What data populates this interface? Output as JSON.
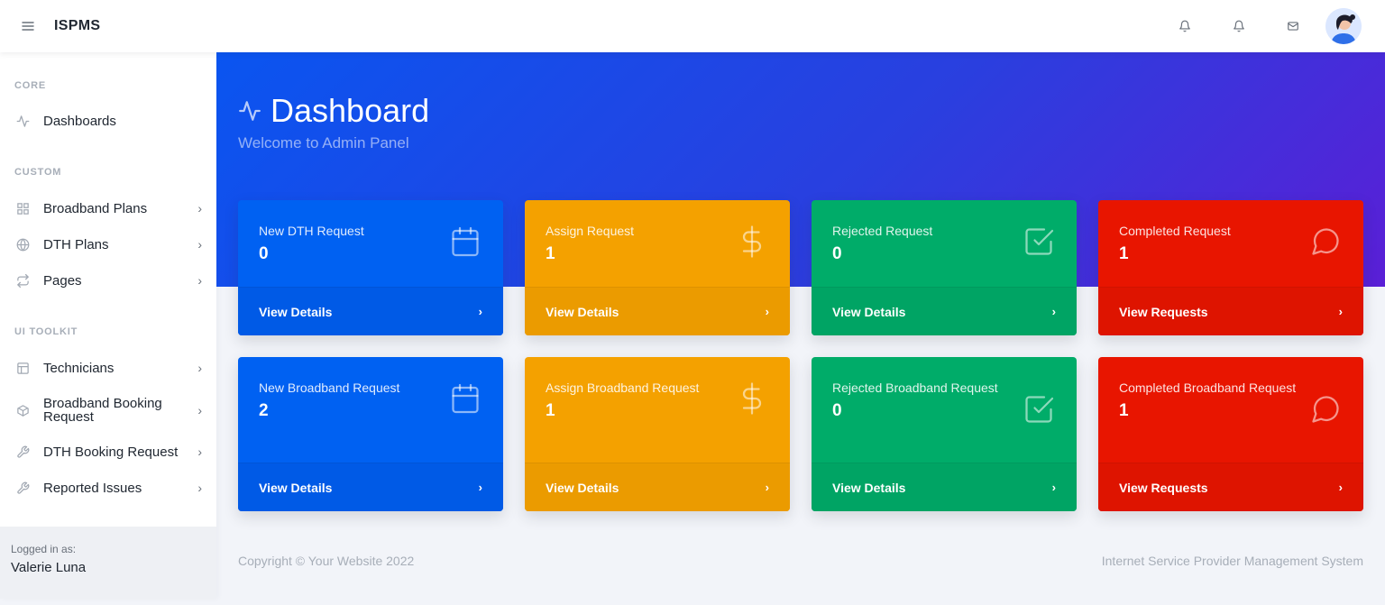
{
  "navbar": {
    "brand": "ISPMS",
    "icons": [
      "menu-icon",
      "bell-icon",
      "bell-icon",
      "mail-icon"
    ]
  },
  "sidebar": {
    "headings": {
      "core": "CORE",
      "custom": "CUSTOM",
      "ui_toolkit": "UI TOOLKIT"
    },
    "items": [
      {
        "label": "Dashboards",
        "icon": "activity-icon",
        "chevron": ""
      },
      {
        "label": "Broadband Plans",
        "icon": "grid-icon",
        "chevron": "›"
      },
      {
        "label": "DTH Plans",
        "icon": "globe-icon",
        "chevron": "›"
      },
      {
        "label": "Pages",
        "icon": "repeat-icon",
        "chevron": "›"
      },
      {
        "label": "Technicians",
        "icon": "layout-icon",
        "chevron": "›"
      },
      {
        "label": "Broadband Booking Request",
        "icon": "package-icon",
        "chevron": "›"
      },
      {
        "label": "DTH Booking Request",
        "icon": "tool-icon",
        "chevron": "›"
      },
      {
        "label": "Reported Issues",
        "icon": "tool-icon",
        "chevron": "›"
      }
    ],
    "footer": {
      "label": "Logged in as:",
      "user": "Valerie Luna"
    }
  },
  "header": {
    "title": "Dashboard",
    "subtitle": "Welcome to Admin Panel"
  },
  "cards": [
    {
      "title": "New DTH Request",
      "value": "0",
      "footer": "View Details",
      "arrow": "›",
      "icon": "calendar-icon",
      "color": "#0061f2"
    },
    {
      "title": "Assign Request",
      "value": "1",
      "footer": "View Details",
      "arrow": "›",
      "icon": "dollar-icon",
      "color": "#f4a100"
    },
    {
      "title": "Rejected Request",
      "value": "0",
      "footer": "View Details",
      "arrow": "›",
      "icon": "check-square-icon",
      "color": "#00ac69"
    },
    {
      "title": "Completed Request",
      "value": "1",
      "footer": "View Requests",
      "arrow": "›",
      "icon": "message-circle-icon",
      "color": "#e81500"
    },
    {
      "title": "New Broadband Request",
      "value": "2",
      "footer": "View Details",
      "arrow": "›",
      "icon": "calendar-icon",
      "color": "#0061f2"
    },
    {
      "title": "Assign Broadband Request",
      "value": "1",
      "footer": "View Details",
      "arrow": "›",
      "icon": "dollar-icon",
      "color": "#f4a100"
    },
    {
      "title": "Rejected Broadband Request",
      "value": "0",
      "footer": "View Details",
      "arrow": "›",
      "icon": "check-square-icon",
      "color": "#00ac69"
    },
    {
      "title": "Completed Broadband Request",
      "value": "1",
      "footer": "View Requests",
      "arrow": "›",
      "icon": "message-circle-icon",
      "color": "#e81500"
    }
  ],
  "footer": {
    "copyright": "Copyright © Your Website 2022",
    "system_name": "Internet Service Provider Management System"
  }
}
